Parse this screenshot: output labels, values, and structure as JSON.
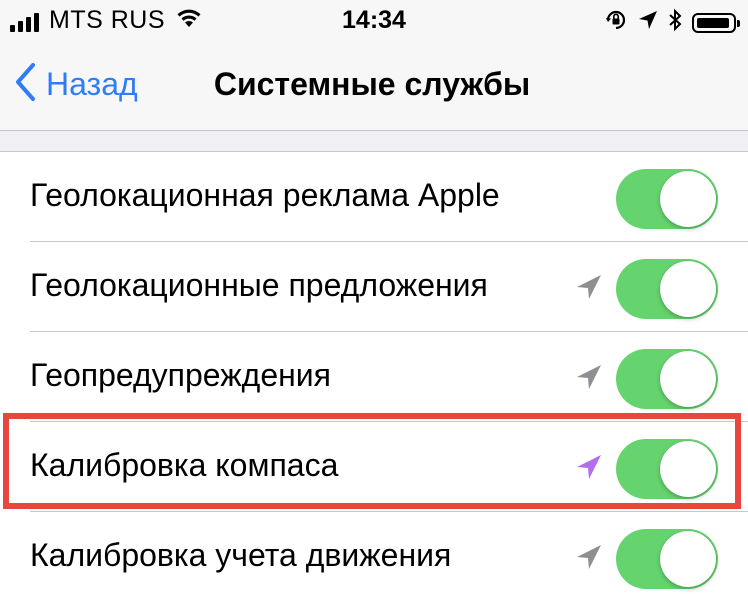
{
  "status_bar": {
    "carrier": "MTS RUS",
    "time": "14:34",
    "icons": [
      "signal-icon",
      "wifi-icon",
      "orientation-lock-icon",
      "location-icon",
      "bluetooth-icon",
      "battery-icon"
    ]
  },
  "nav": {
    "back_label": "Назад",
    "title": "Системные службы"
  },
  "rows": [
    {
      "label": "Геолокационная реклама Apple",
      "location_icon": "none",
      "toggle_on": true
    },
    {
      "label": "Геолокационные предложения",
      "location_icon": "gray",
      "toggle_on": true
    },
    {
      "label": "Геопредупреждения",
      "location_icon": "gray",
      "toggle_on": true
    },
    {
      "label": "Калибровка компаса",
      "location_icon": "purple",
      "toggle_on": true,
      "highlighted": true
    },
    {
      "label": "Калибровка учета движения",
      "location_icon": "gray",
      "toggle_on": true
    }
  ],
  "colors": {
    "toggle_on": "#65d46e",
    "link_blue": "#2f7cf6",
    "location_gray": "#8e8e93",
    "location_purple": "#b46cf0",
    "highlight_red": "#e8463f"
  }
}
